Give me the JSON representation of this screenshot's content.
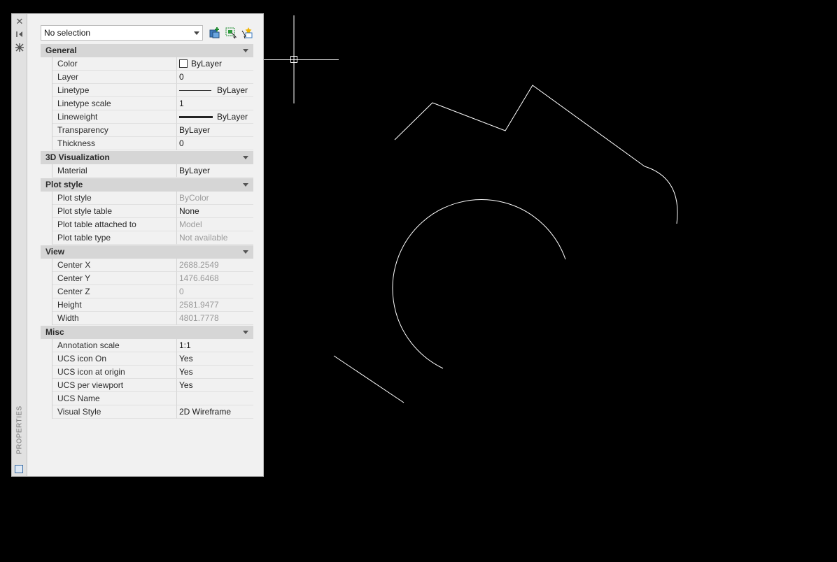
{
  "palette": {
    "title": "PROPERTIES",
    "selection": "No selection",
    "strip_icons": [
      "close-icon",
      "auto-hide-icon",
      "properties-settings-icon"
    ],
    "tool_icons": [
      "toggle-pickadd-icon",
      "select-objects-icon",
      "quick-select-icon"
    ]
  },
  "sections": [
    {
      "title": "General",
      "rows": [
        {
          "name": "Color",
          "value": "ByLayer",
          "kind": "color"
        },
        {
          "name": "Layer",
          "value": "0"
        },
        {
          "name": "Linetype",
          "value": "ByLayer",
          "kind": "linetype"
        },
        {
          "name": "Linetype scale",
          "value": "1"
        },
        {
          "name": "Lineweight",
          "value": "ByLayer",
          "kind": "lineweight"
        },
        {
          "name": "Transparency",
          "value": "ByLayer"
        },
        {
          "name": "Thickness",
          "value": "0"
        }
      ]
    },
    {
      "title": "3D Visualization",
      "rows": [
        {
          "name": "Material",
          "value": "ByLayer"
        }
      ]
    },
    {
      "title": "Plot style",
      "rows": [
        {
          "name": "Plot style",
          "value": "ByColor",
          "disabled": true
        },
        {
          "name": "Plot style table",
          "value": "None"
        },
        {
          "name": "Plot table attached to",
          "value": "Model",
          "disabled": true
        },
        {
          "name": "Plot table type",
          "value": "Not available",
          "disabled": true
        }
      ]
    },
    {
      "title": "View",
      "rows": [
        {
          "name": "Center X",
          "value": "2688.2549",
          "disabled": true
        },
        {
          "name": "Center Y",
          "value": "1476.6468",
          "disabled": true
        },
        {
          "name": "Center Z",
          "value": "0",
          "disabled": true
        },
        {
          "name": "Height",
          "value": "2581.9477",
          "disabled": true
        },
        {
          "name": "Width",
          "value": "4801.7778",
          "disabled": true
        }
      ]
    },
    {
      "title": "Misc",
      "rows": [
        {
          "name": "Annotation scale",
          "value": "1:1"
        },
        {
          "name": "UCS icon On",
          "value": "Yes"
        },
        {
          "name": "UCS icon at origin",
          "value": "Yes"
        },
        {
          "name": "UCS per viewport",
          "value": "Yes"
        },
        {
          "name": "UCS Name",
          "value": ""
        },
        {
          "name": "Visual Style",
          "value": "2D Wireframe"
        }
      ]
    }
  ],
  "colors": {
    "canvas_bg": "#000000",
    "geometry": "#ffffff",
    "header_bg": "#d6d6d6",
    "panel_bg": "#f1f1f1"
  }
}
